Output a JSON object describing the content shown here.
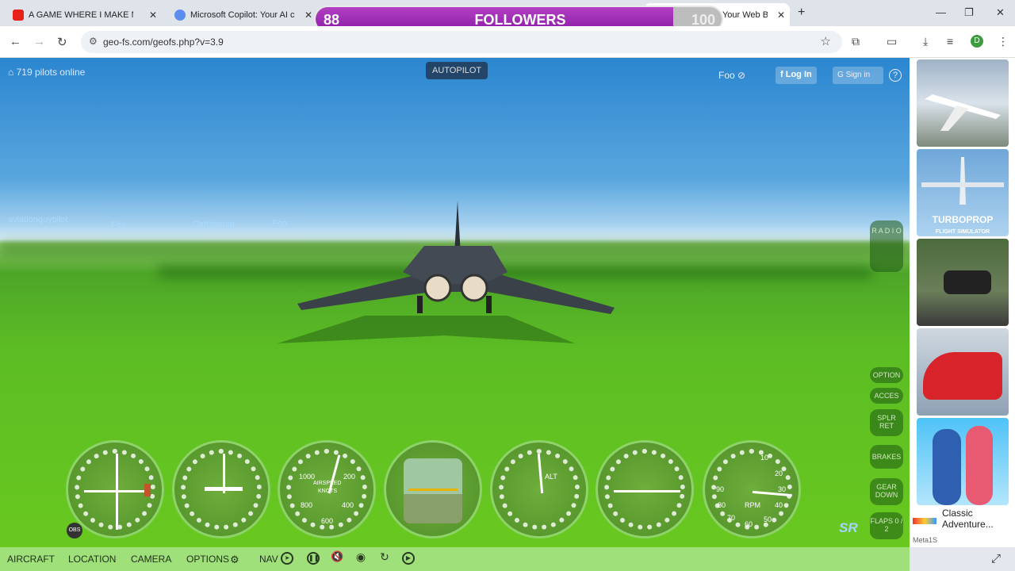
{
  "browser": {
    "tabs": [
      {
        "title": "A GAME WHERE I MAKE MY",
        "favicon_color": "#e62117"
      },
      {
        "title": "Microsoft Copilot: Your AI com",
        "favicon_color": "#5a8dee"
      },
      {
        "title": "FS - Fly in Your Web Bro",
        "favicon_color": "#3b82c4"
      }
    ],
    "new_tab": "+",
    "close_glyph": "✕",
    "window_controls": [
      "—",
      "❐",
      "✕"
    ],
    "url": "geo-fs.com/geofs.php?v=3.9",
    "profile_initial": "D"
  },
  "followers": {
    "label": "FOLLOWERS",
    "current": "88",
    "goal": "100",
    "progress": 0.88
  },
  "game": {
    "pilots_online": "719 pilots online",
    "autopilot": "AUTOPILOT",
    "foo": "Foo",
    "login": "Log In",
    "signin": "Sign in",
    "help": "?",
    "player_tags": [
      "aviationguypilot",
      "Foo",
      "Oshimenin",
      "Foo"
    ],
    "right_buttons": {
      "radio": "R A D I O",
      "option": "OPTION",
      "acces": "ACCES",
      "splr": "SPLR RET",
      "brakes": "BRAKES",
      "gear": "GEAR DOWN",
      "flaps": "FLAPS 0 / 2"
    },
    "gauges": {
      "airspeed_labels": [
        "1000",
        "200",
        "800",
        "400",
        "600",
        "AIRSPEED",
        "KNOTS"
      ],
      "alt_label": "ALT",
      "rpm_labels": [
        "10",
        "20",
        "30",
        "40",
        "50",
        "60",
        "70",
        "80",
        "90",
        "RPM"
      ]
    },
    "obs": "OBS",
    "sr": "SR",
    "bottom": {
      "aircraft": "AIRCRAFT",
      "location": "LOCATION",
      "camera": "CAMERA",
      "options": "OPTIONS",
      "nav": "NAV"
    }
  },
  "ads": {
    "turboprop": "TURBOPROP",
    "turboprop_sub": "FLIGHT SIMULATOR",
    "game_title": "Classic Adventure...",
    "sponsor": "Meta1S"
  }
}
